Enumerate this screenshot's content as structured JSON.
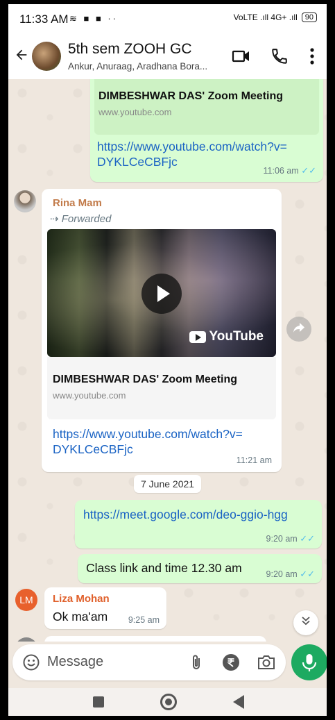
{
  "status_bar": {
    "time": "11:33 AM",
    "notif_icons": "≋ ■ ■ ··",
    "network_icons": "VoLTE .ıll 4G+ .ıll",
    "battery": "90"
  },
  "app_bar": {
    "chat_title": "5th sem ZOOH GC",
    "chat_subtitle": "Ankur, Anuraag, Aradhana Bora..."
  },
  "messages": {
    "m1": {
      "preview_title": "DIMBESHWAR DAS' Zoom Meeting",
      "preview_url": "www.youtube.com",
      "link_line1": "https://www.youtube.com/watch?v=",
      "link_line2": "DYKLCeCBFjc",
      "time": "11:06 am",
      "ticks": "✓✓"
    },
    "m2": {
      "sender": "Rina Mam",
      "forwarded": "Forwarded",
      "video_brand": "YouTube",
      "preview_title": "DIMBESHWAR DAS' Zoom Meeting",
      "preview_url": "www.youtube.com",
      "link_line1": "https://www.youtube.com/watch?v=",
      "link_line2": "DYKLCeCBFjc",
      "time": "11:21 am"
    },
    "date_chip": "7 June 2021",
    "m3": {
      "link": "https://meet.google.com/deo-ggio-hgg",
      "time": "9:20 am",
      "ticks": "✓✓"
    },
    "m4": {
      "text": "Class link and time 12.30 am",
      "time": "9:20 am",
      "ticks": "✓✓"
    },
    "m5": {
      "sender": "Liza Mohan",
      "avatar_initials": "LM",
      "text": "Ok ma'am",
      "time": "9:25 am"
    }
  },
  "composer": {
    "placeholder": "Message"
  },
  "colors": {
    "outgoing_bubble": "#d9fdd3",
    "incoming_bubble": "#ffffff",
    "link": "#1a63c4",
    "accent_green": "#1daa61",
    "rina_name": "#c27b4a",
    "liza_name": "#e0602b",
    "read_ticks": "#53bdeb"
  },
  "icons": [
    "back-arrow-icon",
    "video-call-icon",
    "phone-icon",
    "more-vert-icon",
    "forward-icon",
    "play-icon",
    "share-icon",
    "scroll-down-icon",
    "emoji-icon",
    "attach-icon",
    "rupee-icon",
    "camera-icon",
    "mic-icon",
    "nav-recents-icon",
    "nav-home-icon",
    "nav-back-icon"
  ]
}
